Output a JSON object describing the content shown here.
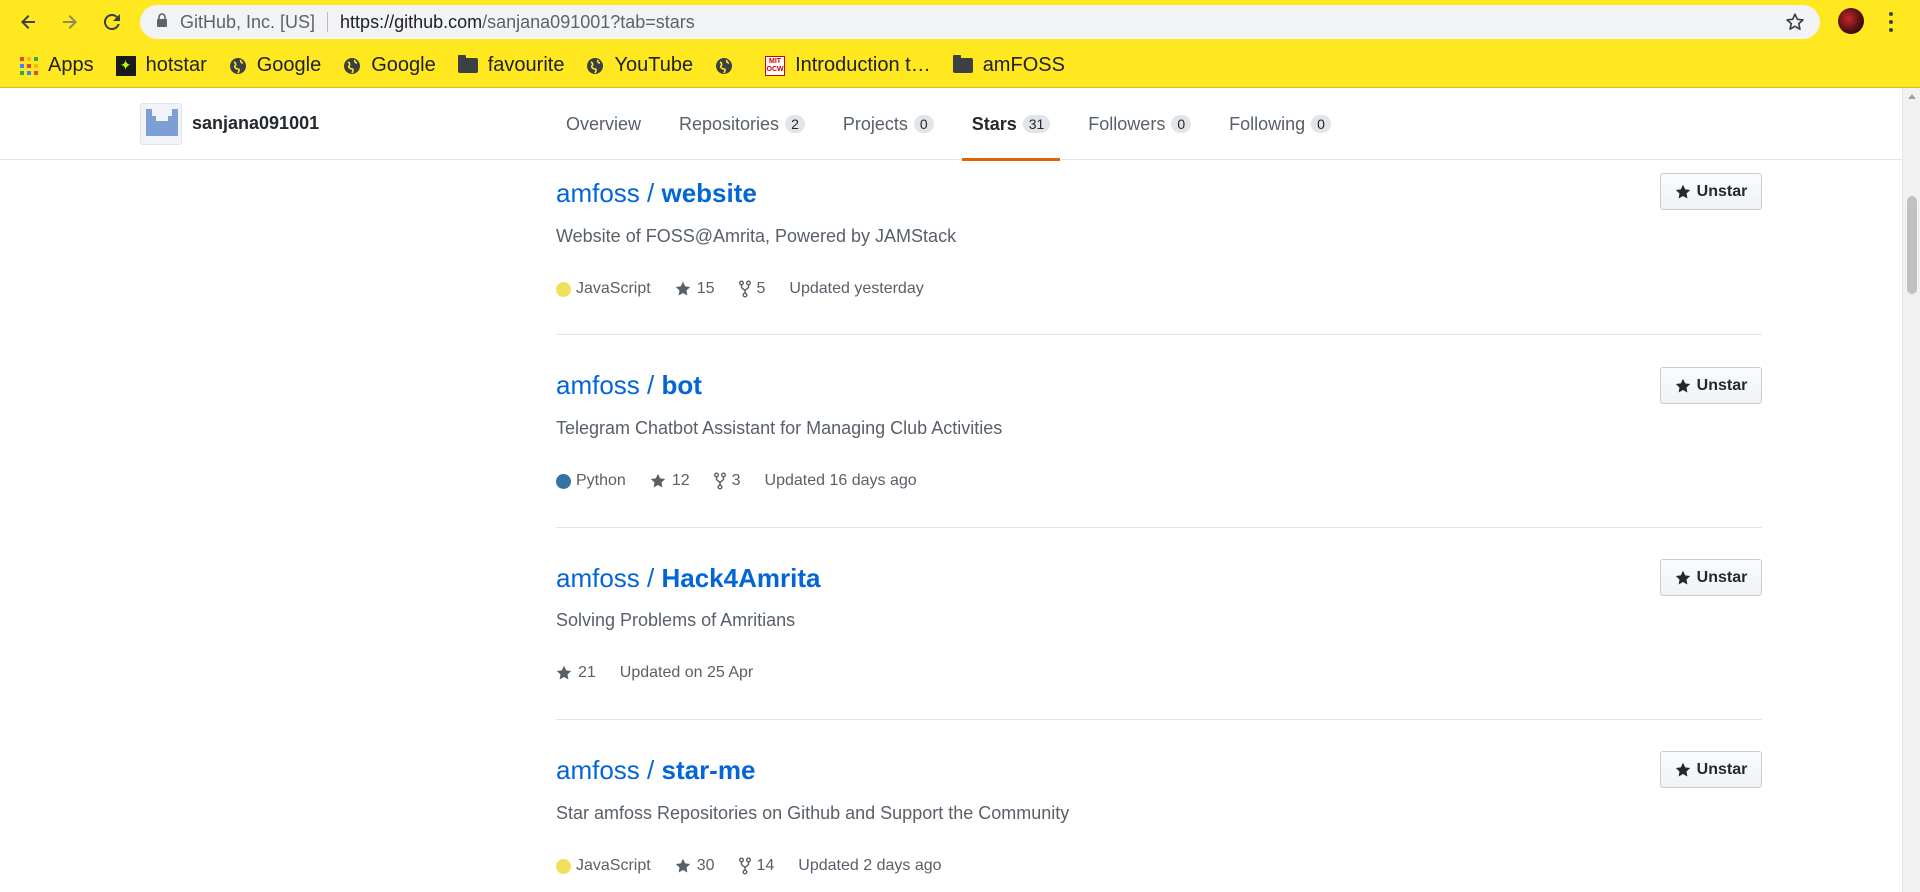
{
  "browser": {
    "site_identity": "GitHub, Inc. [US]",
    "url_host": "https://github.com",
    "url_path": "/sanjana091001?tab=stars"
  },
  "bookmarks": [
    {
      "label": "Apps",
      "icon": "apps-grid-icon"
    },
    {
      "label": "hotstar",
      "icon": "hotstar-icon"
    },
    {
      "label": "Google",
      "icon": "globe-icon"
    },
    {
      "label": "Google",
      "icon": "globe-icon"
    },
    {
      "label": "favourite",
      "icon": "folder-icon"
    },
    {
      "label": "YouTube",
      "icon": "globe-icon"
    },
    {
      "label": "",
      "icon": "globe-icon"
    },
    {
      "label": "Introduction t…",
      "icon": "mit-ocw-icon"
    },
    {
      "label": "amFOSS",
      "icon": "folder-icon"
    }
  ],
  "profile": {
    "username": "sanjana091001"
  },
  "tabs": [
    {
      "label": "Overview",
      "count": ""
    },
    {
      "label": "Repositories",
      "count": "2"
    },
    {
      "label": "Projects",
      "count": "0"
    },
    {
      "label": "Stars",
      "count": "31",
      "active": true
    },
    {
      "label": "Followers",
      "count": "0"
    },
    {
      "label": "Following",
      "count": "0"
    }
  ],
  "repos": [
    {
      "owner": "amfoss /",
      "name": "website",
      "description": "Website of FOSS@Amrita, Powered by JAMStack",
      "language": "JavaScript",
      "language_color": "#f1e05a",
      "stars": "15",
      "forks": "5",
      "updated": "Updated yesterday",
      "button": "Unstar"
    },
    {
      "owner": "amfoss /",
      "name": "bot",
      "description": "Telegram Chatbot Assistant for Managing Club Activities",
      "language": "Python",
      "language_color": "#3572A5",
      "stars": "12",
      "forks": "3",
      "updated": "Updated 16 days ago",
      "button": "Unstar"
    },
    {
      "owner": "amfoss /",
      "name": "Hack4Amrita",
      "description": "Solving Problems of Amritians",
      "language": "",
      "language_color": "",
      "stars": "21",
      "forks": "",
      "updated": "Updated on 25 Apr",
      "button": "Unstar"
    },
    {
      "owner": "amfoss /",
      "name": "star-me",
      "description": "Star amfoss Repositories on Github and Support the Community",
      "language": "JavaScript",
      "language_color": "#f1e05a",
      "stars": "30",
      "forks": "14",
      "updated": "Updated 2 days ago",
      "button": "Unstar"
    }
  ],
  "colors": {
    "chrome_theme": "#ffe81f",
    "link_blue": "#0366d6",
    "active_tab_underline": "#e36209"
  }
}
